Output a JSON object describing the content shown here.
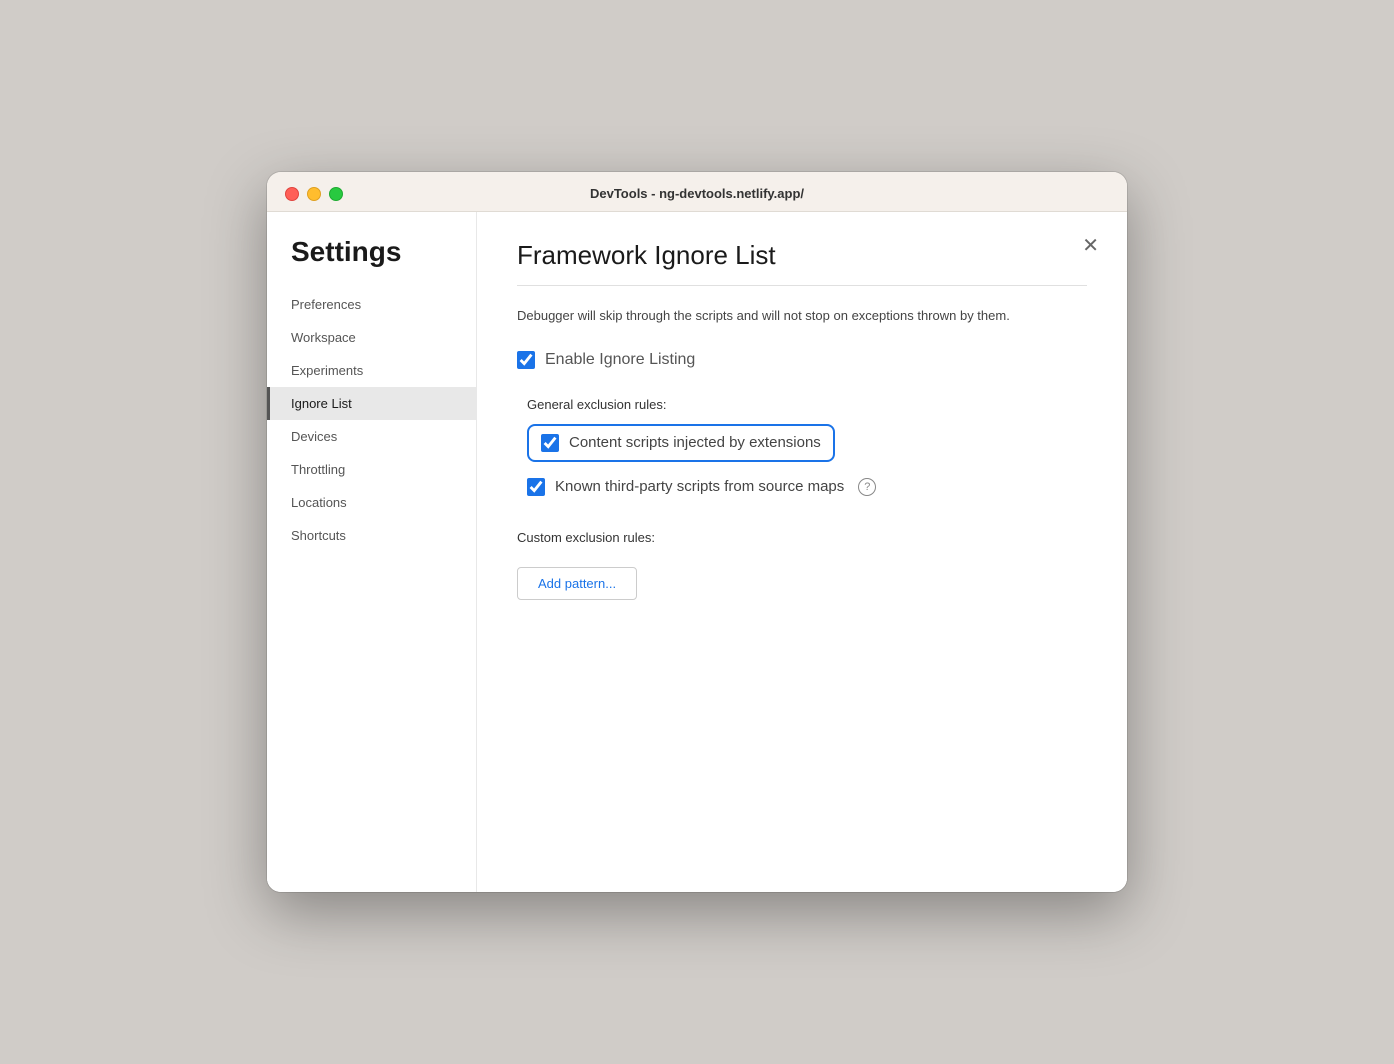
{
  "window": {
    "title": "DevTools - ng-devtools.netlify.app/"
  },
  "sidebar": {
    "heading": "Settings",
    "items": [
      {
        "id": "preferences",
        "label": "Preferences",
        "active": false
      },
      {
        "id": "workspace",
        "label": "Workspace",
        "active": false
      },
      {
        "id": "experiments",
        "label": "Experiments",
        "active": false
      },
      {
        "id": "ignore-list",
        "label": "Ignore List",
        "active": true
      },
      {
        "id": "devices",
        "label": "Devices",
        "active": false
      },
      {
        "id": "throttling",
        "label": "Throttling",
        "active": false
      },
      {
        "id": "locations",
        "label": "Locations",
        "active": false
      },
      {
        "id": "shortcuts",
        "label": "Shortcuts",
        "active": false
      }
    ]
  },
  "main": {
    "title": "Framework Ignore List",
    "description": "Debugger will skip through the scripts and will not stop on exceptions thrown by them.",
    "enable_ignore_listing_label": "Enable Ignore Listing",
    "general_exclusion_rules_label": "General exclusion rules:",
    "content_scripts_label": "Content scripts injected by extensions",
    "known_scripts_label": "Known third-party scripts from source maps",
    "custom_exclusion_rules_label": "Custom exclusion rules:",
    "add_pattern_label": "Add pattern...",
    "close_icon": "✕"
  },
  "checkboxes": {
    "enable_ignore": true,
    "content_scripts": true,
    "known_scripts": true
  }
}
